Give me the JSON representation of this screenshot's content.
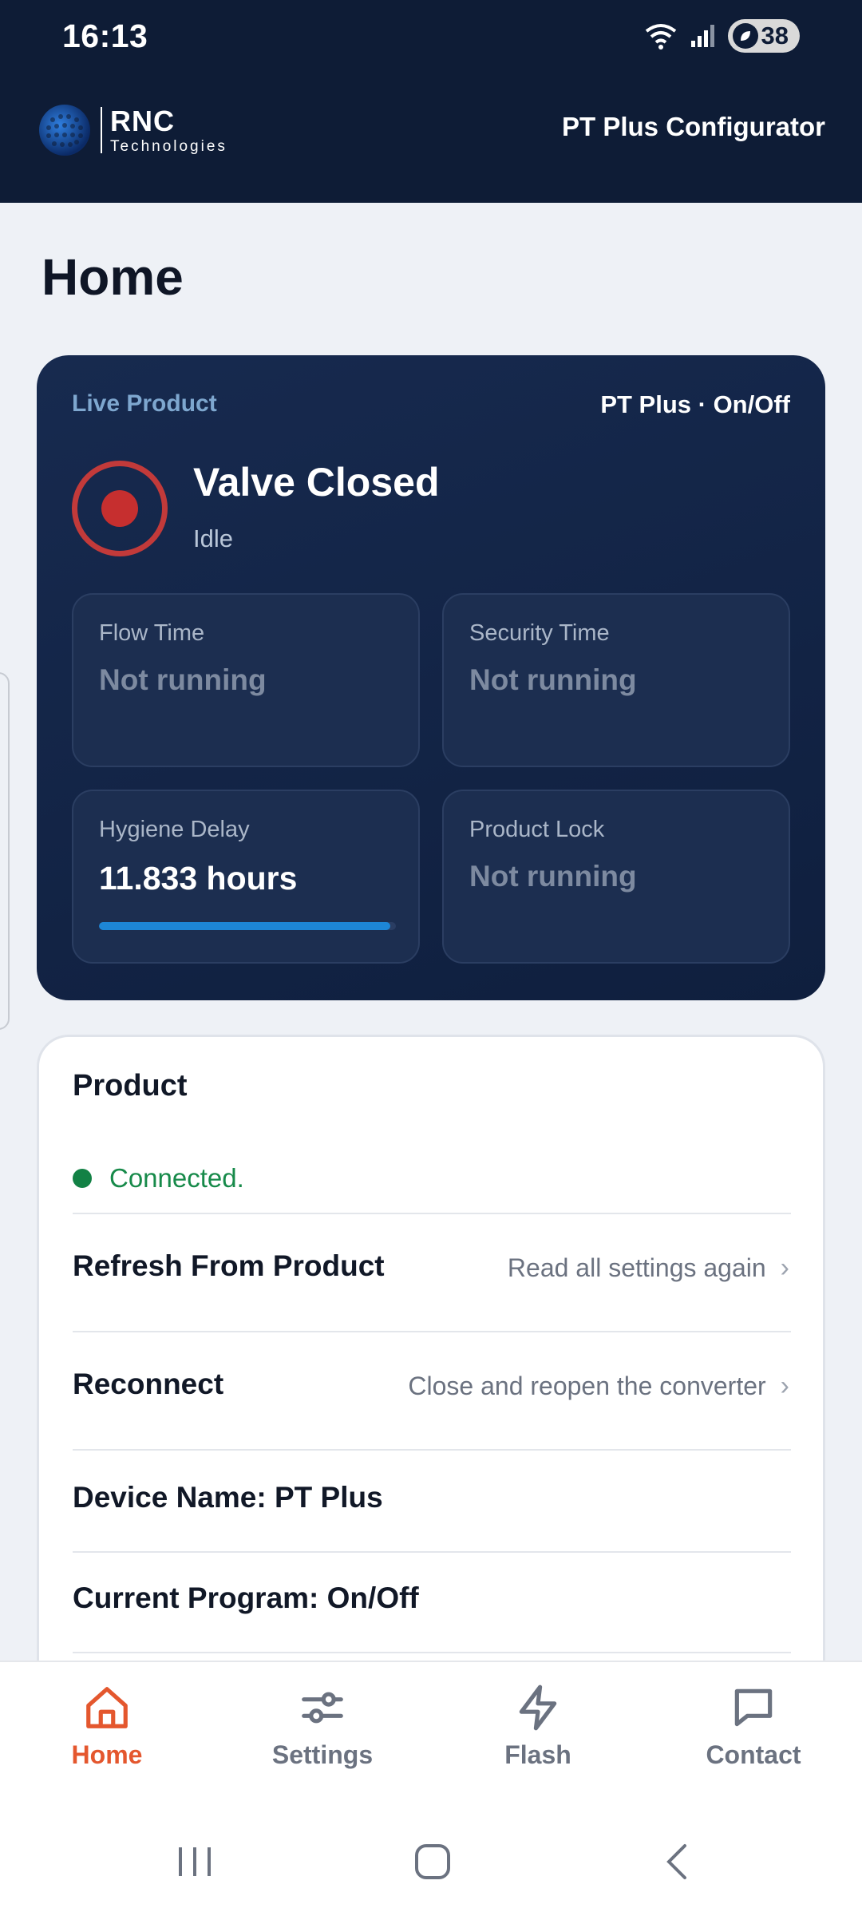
{
  "status_bar": {
    "time": "16:13",
    "battery": "38"
  },
  "header": {
    "logo_name": "RNC",
    "logo_sub": "Technologies",
    "title": "PT Plus Configurator"
  },
  "page": {
    "title": "Home"
  },
  "live": {
    "label": "Live Product",
    "product": "PT Plus · On/Off",
    "valve_state": "Valve Closed",
    "valve_sub": "Idle",
    "tiles": [
      {
        "label": "Flow Time",
        "value": "Not running"
      },
      {
        "label": "Security Time",
        "value": "Not running"
      },
      {
        "label": "Hygiene Delay",
        "value": "11.833 hours",
        "progress": 0.98
      },
      {
        "label": "Product Lock",
        "value": "Not running"
      }
    ]
  },
  "product": {
    "title": "Product",
    "status": "Connected.",
    "refresh_label": "Refresh From Product",
    "refresh_hint": "Read all settings again",
    "reconnect_label": "Reconnect",
    "reconnect_hint": "Close and reopen the converter",
    "device_name": "Device Name: PT Plus",
    "current_program": "Current Program: On/Off"
  },
  "nav": {
    "items": [
      {
        "label": "Home",
        "icon": "home-icon"
      },
      {
        "label": "Settings",
        "icon": "sliders-icon"
      },
      {
        "label": "Flash",
        "icon": "lightning-icon"
      },
      {
        "label": "Contact",
        "icon": "chat-icon"
      }
    ],
    "active": "Home"
  },
  "colors": {
    "header_bg": "#0e1c36",
    "accent": "#e4572e",
    "valve_red": "#c62f2f",
    "connected_green": "#128145",
    "progress_blue": "#1d86d6"
  }
}
